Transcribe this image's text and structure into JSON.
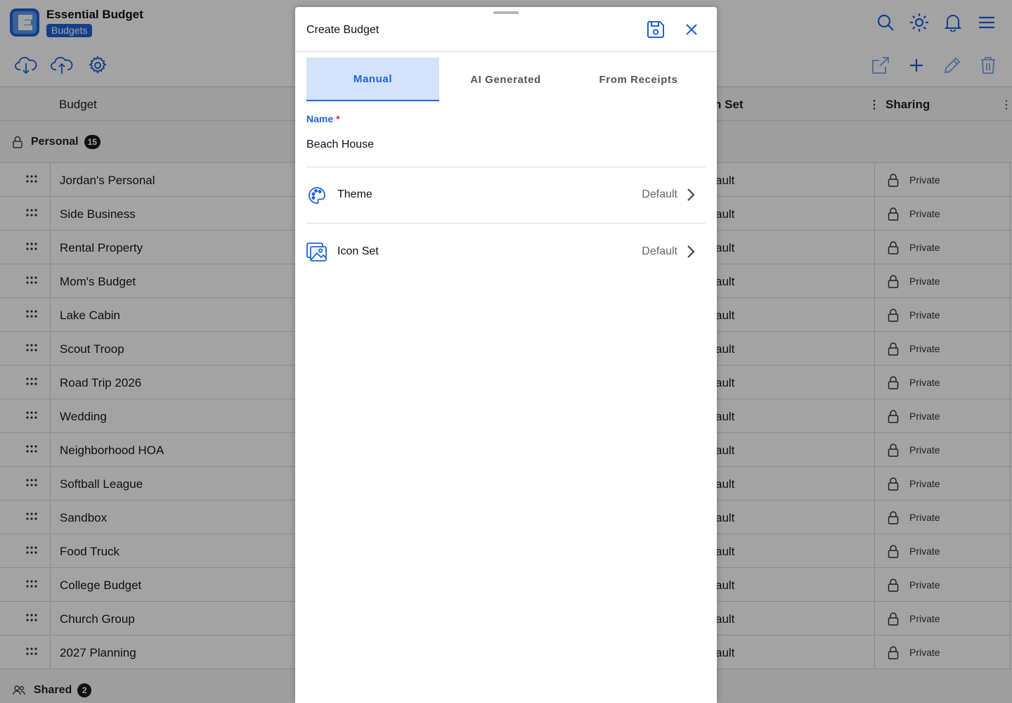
{
  "app": {
    "name": "Essential Budget",
    "section": "Budgets"
  },
  "table": {
    "col_budget": "Budget",
    "col_iconset": "n Set",
    "col_sharing": "Sharing",
    "group_personal": {
      "label": "Personal",
      "count": "15"
    },
    "group_shared": {
      "label": "Shared",
      "count": "2"
    },
    "rows": [
      {
        "name": "Jordan's Personal",
        "iconset": "ault",
        "sharing": "Private"
      },
      {
        "name": "Side Business",
        "iconset": "ault",
        "sharing": "Private"
      },
      {
        "name": "Rental Property",
        "iconset": "ault",
        "sharing": "Private"
      },
      {
        "name": "Mom's Budget",
        "iconset": "ault",
        "sharing": "Private"
      },
      {
        "name": "Lake Cabin",
        "iconset": "ault",
        "sharing": "Private"
      },
      {
        "name": "Scout Troop",
        "iconset": "ault",
        "sharing": "Private"
      },
      {
        "name": "Road Trip 2026",
        "iconset": "ault",
        "sharing": "Private"
      },
      {
        "name": "Wedding",
        "iconset": "ault",
        "sharing": "Private"
      },
      {
        "name": "Neighborhood HOA",
        "iconset": "ault",
        "sharing": "Private"
      },
      {
        "name": "Softball League",
        "iconset": "ault",
        "sharing": "Private"
      },
      {
        "name": "Sandbox",
        "iconset": "ault",
        "sharing": "Private"
      },
      {
        "name": "Food Truck",
        "iconset": "ault",
        "sharing": "Private"
      },
      {
        "name": "College Budget",
        "iconset": "ault",
        "sharing": "Private"
      },
      {
        "name": "Church Group",
        "iconset": "ault",
        "sharing": "Private"
      },
      {
        "name": "2027 Planning",
        "iconset": "ault",
        "sharing": "Private"
      }
    ]
  },
  "modal": {
    "title": "Create Budget",
    "tabs": [
      {
        "label": "Manual"
      },
      {
        "label": "AI Generated"
      },
      {
        "label": "From Receipts"
      }
    ],
    "name_label": "Name",
    "name_required": "*",
    "name_value": "Beach House",
    "theme": {
      "label": "Theme",
      "value": "Default"
    },
    "iconset": {
      "label": "Icon Set",
      "value": "Default"
    }
  },
  "colors": {
    "accent": "#1f63d8",
    "tab_active_bg": "#d2e3fb",
    "required": "#d32f2f"
  }
}
